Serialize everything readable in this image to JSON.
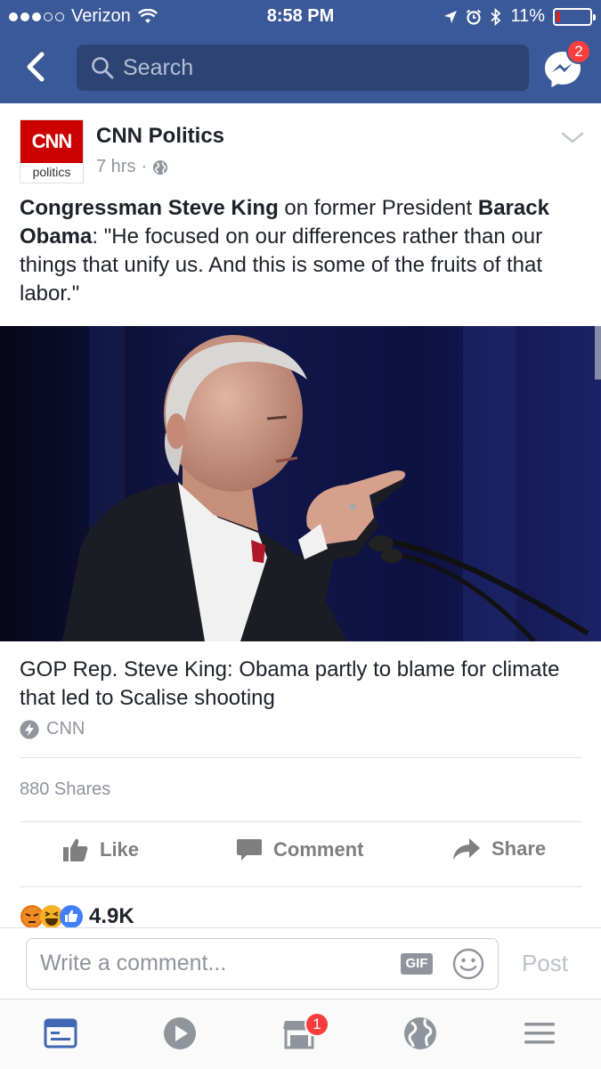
{
  "status_bar": {
    "carrier": "Verizon",
    "time": "8:58 PM",
    "battery_percent": "11%",
    "battery_level": 0.11
  },
  "nav": {
    "search_placeholder": "Search",
    "messenger_badge": "2"
  },
  "post": {
    "page_name": "CNN Politics",
    "logo_text": "CNN",
    "logo_sub": "politics",
    "time_ago": "7 hrs",
    "separator": "·",
    "text_parts": [
      {
        "text": "Congressman Steve King",
        "bold": true
      },
      {
        "text": " on former President ",
        "bold": false
      },
      {
        "text": "Barack Obama",
        "bold": true
      },
      {
        "text": ": \"He focused on our differences rather than our things that unify us. And this is some of the fruits of that labor.\"",
        "bold": false
      }
    ],
    "link_title": "GOP Rep. Steve King: Obama partly to blame for climate that led to Scalise shooting",
    "link_source": "CNN",
    "shares": "880 Shares",
    "reaction_count": "4.9K"
  },
  "actions": {
    "like": "Like",
    "comment": "Comment",
    "share": "Share"
  },
  "composer": {
    "placeholder": "Write a comment...",
    "gif_label": "GIF",
    "post_label": "Post"
  },
  "tabbar": {
    "marketplace_badge": "1"
  },
  "colors": {
    "brand_blue": "#3b5998",
    "cnn_red": "#cc0000",
    "badge_red": "#fa3e3e"
  }
}
